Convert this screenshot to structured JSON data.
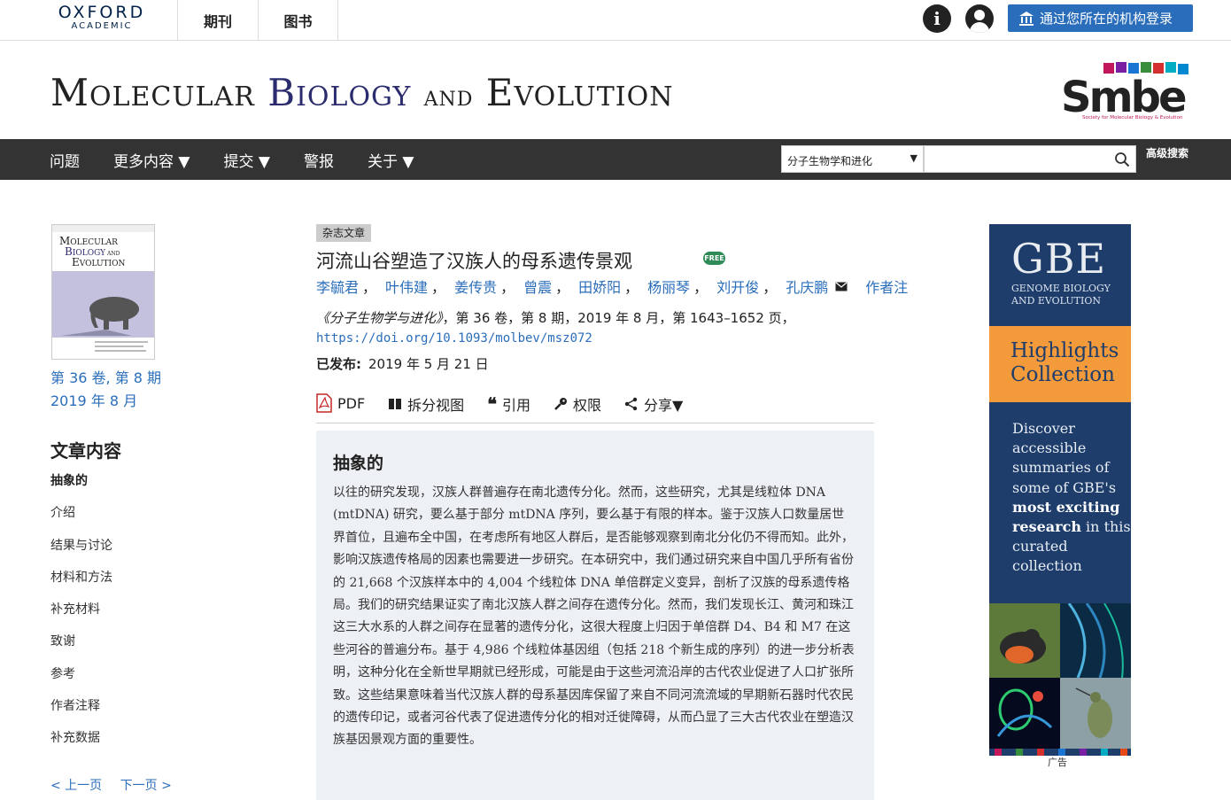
{
  "topbar": {
    "brand_line1": "OXFORD",
    "brand_line2": "ACADEMIC",
    "nav": [
      "期刊",
      "图书"
    ],
    "info_icon": "i",
    "institution_button": "通过您所在的机构登录"
  },
  "masthead": {
    "title_part1_cap": "M",
    "title_part1_rest": "OLECULAR",
    "title_part2_cap": "B",
    "title_part2_rest": "IOLOGY",
    "title_and": "AND",
    "title_part3_cap": "E",
    "title_part3_rest": "VOLUTION",
    "society_logo_text": "Smbe",
    "society_logo_sub": "Society for Molecular Biology & Evolution"
  },
  "navbar": {
    "items": [
      "问题",
      "更多内容 ▼",
      "提交 ▼",
      "警报",
      "关于 ▼"
    ],
    "search_scope": "分子生物学和进化",
    "search_placeholder": "",
    "advanced_search": "高级搜索"
  },
  "sidebar": {
    "issue_line1": "第 36 卷, 第 8 期",
    "issue_line2": "2019 年 8 月",
    "toc_title": "文章内容",
    "toc_items": [
      "抽象的",
      "介绍",
      "结果与讨论",
      "材料和方法",
      "补充材料",
      "致谢",
      "参考",
      "作者注释",
      "补充数据"
    ],
    "prev": "< 上一页",
    "next": "下一页 >"
  },
  "article": {
    "type_badge": "杂志文章",
    "title": "河流山谷塑造了汉族人的母系遗传景观",
    "free_badge": "FREE",
    "authors": [
      "李毓君",
      "叶伟建",
      "姜传贵",
      "曾震",
      "田娇阳",
      "杨丽琴",
      "刘开俊",
      "孔庆鹏"
    ],
    "author_sep": "，",
    "author_notes": "作者注",
    "citation_journal": "《分子生物学与进化》",
    "citation_rest": "，第 36 卷，第 8 期，2019 年 8 月，第 1643–1652 页，",
    "doi": "https://doi.org/10.1093/molbev/msz072",
    "published_label": "已发布:",
    "published_date": "2019 年 5 月 21 日",
    "tools": {
      "pdf": "PDF",
      "split_view": "拆分视图",
      "cite": "引用",
      "permissions": "权限",
      "share": "分享▼"
    },
    "abstract_heading": "抽象的",
    "abstract": "以往的研究发现，汉族人群普遍存在南北遗传分化。然而，这些研究，尤其是线粒体 DNA (mtDNA) 研究，要么基于部分 mtDNA 序列，要么基于有限的样本。鉴于汉族人口数量居世界首位，且遍布全中国，在考虑所有地区人群后，是否能够观察到南北分化仍不得而知。此外，影响汉族遗传格局的因素也需要进一步研究。在本研究中，我们通过研究来自中国几乎所有省份的 21,668 个汉族样本中的 4,004 个线粒体 DNA 单倍群定义变异，剖析了汉族的母系遗传格局。我们的研究结果证实了南北汉族人群之间存在遗传分化。然而，我们发现长江、黄河和珠江这三大水系的人群之间存在显著的遗传分化，这很大程度上归因于单倍群 D4、B4 和 M7 在这些河谷的普遍分布。基于 4,986 个线粒体基因组（包括 218 个新生成的序列）的进一步分析表明，这种分化在全新世早期就已经形成，可能是由于这些河流沿岸的古代农业促进了人口扩张所致。这些结果意味着当代汉族人群的母系基因库保留了来自不同河流流域的早期新石器时代农民的遗传印记，或者河谷代表了促进遗传分化的相对迁徙障碍，从而凸显了三大古代农业在塑造汉族基因景观方面的重要性。"
  },
  "ad": {
    "logo": "GBE",
    "logo_sub1": "GENOME BIOLOGY",
    "logo_sub2": "AND EVOLUTION",
    "highlights1": "Highlights",
    "highlights2": "Collection",
    "discover_lines": [
      "Discover",
      "accessible",
      "summaries of",
      "some of GBE's"
    ],
    "bold_line1": "most exciting",
    "bold_line2": "research",
    "line_after": " in this",
    "tail_lines": [
      "curated",
      "collection"
    ],
    "label": "广告"
  },
  "colors": {
    "link": "#2a6ebb",
    "navbar": "#333333",
    "abstract_bg": "#edf1f5",
    "ad_blue": "#1e3d6b",
    "ad_orange": "#f39a3b",
    "free_green": "#2e8b57"
  }
}
